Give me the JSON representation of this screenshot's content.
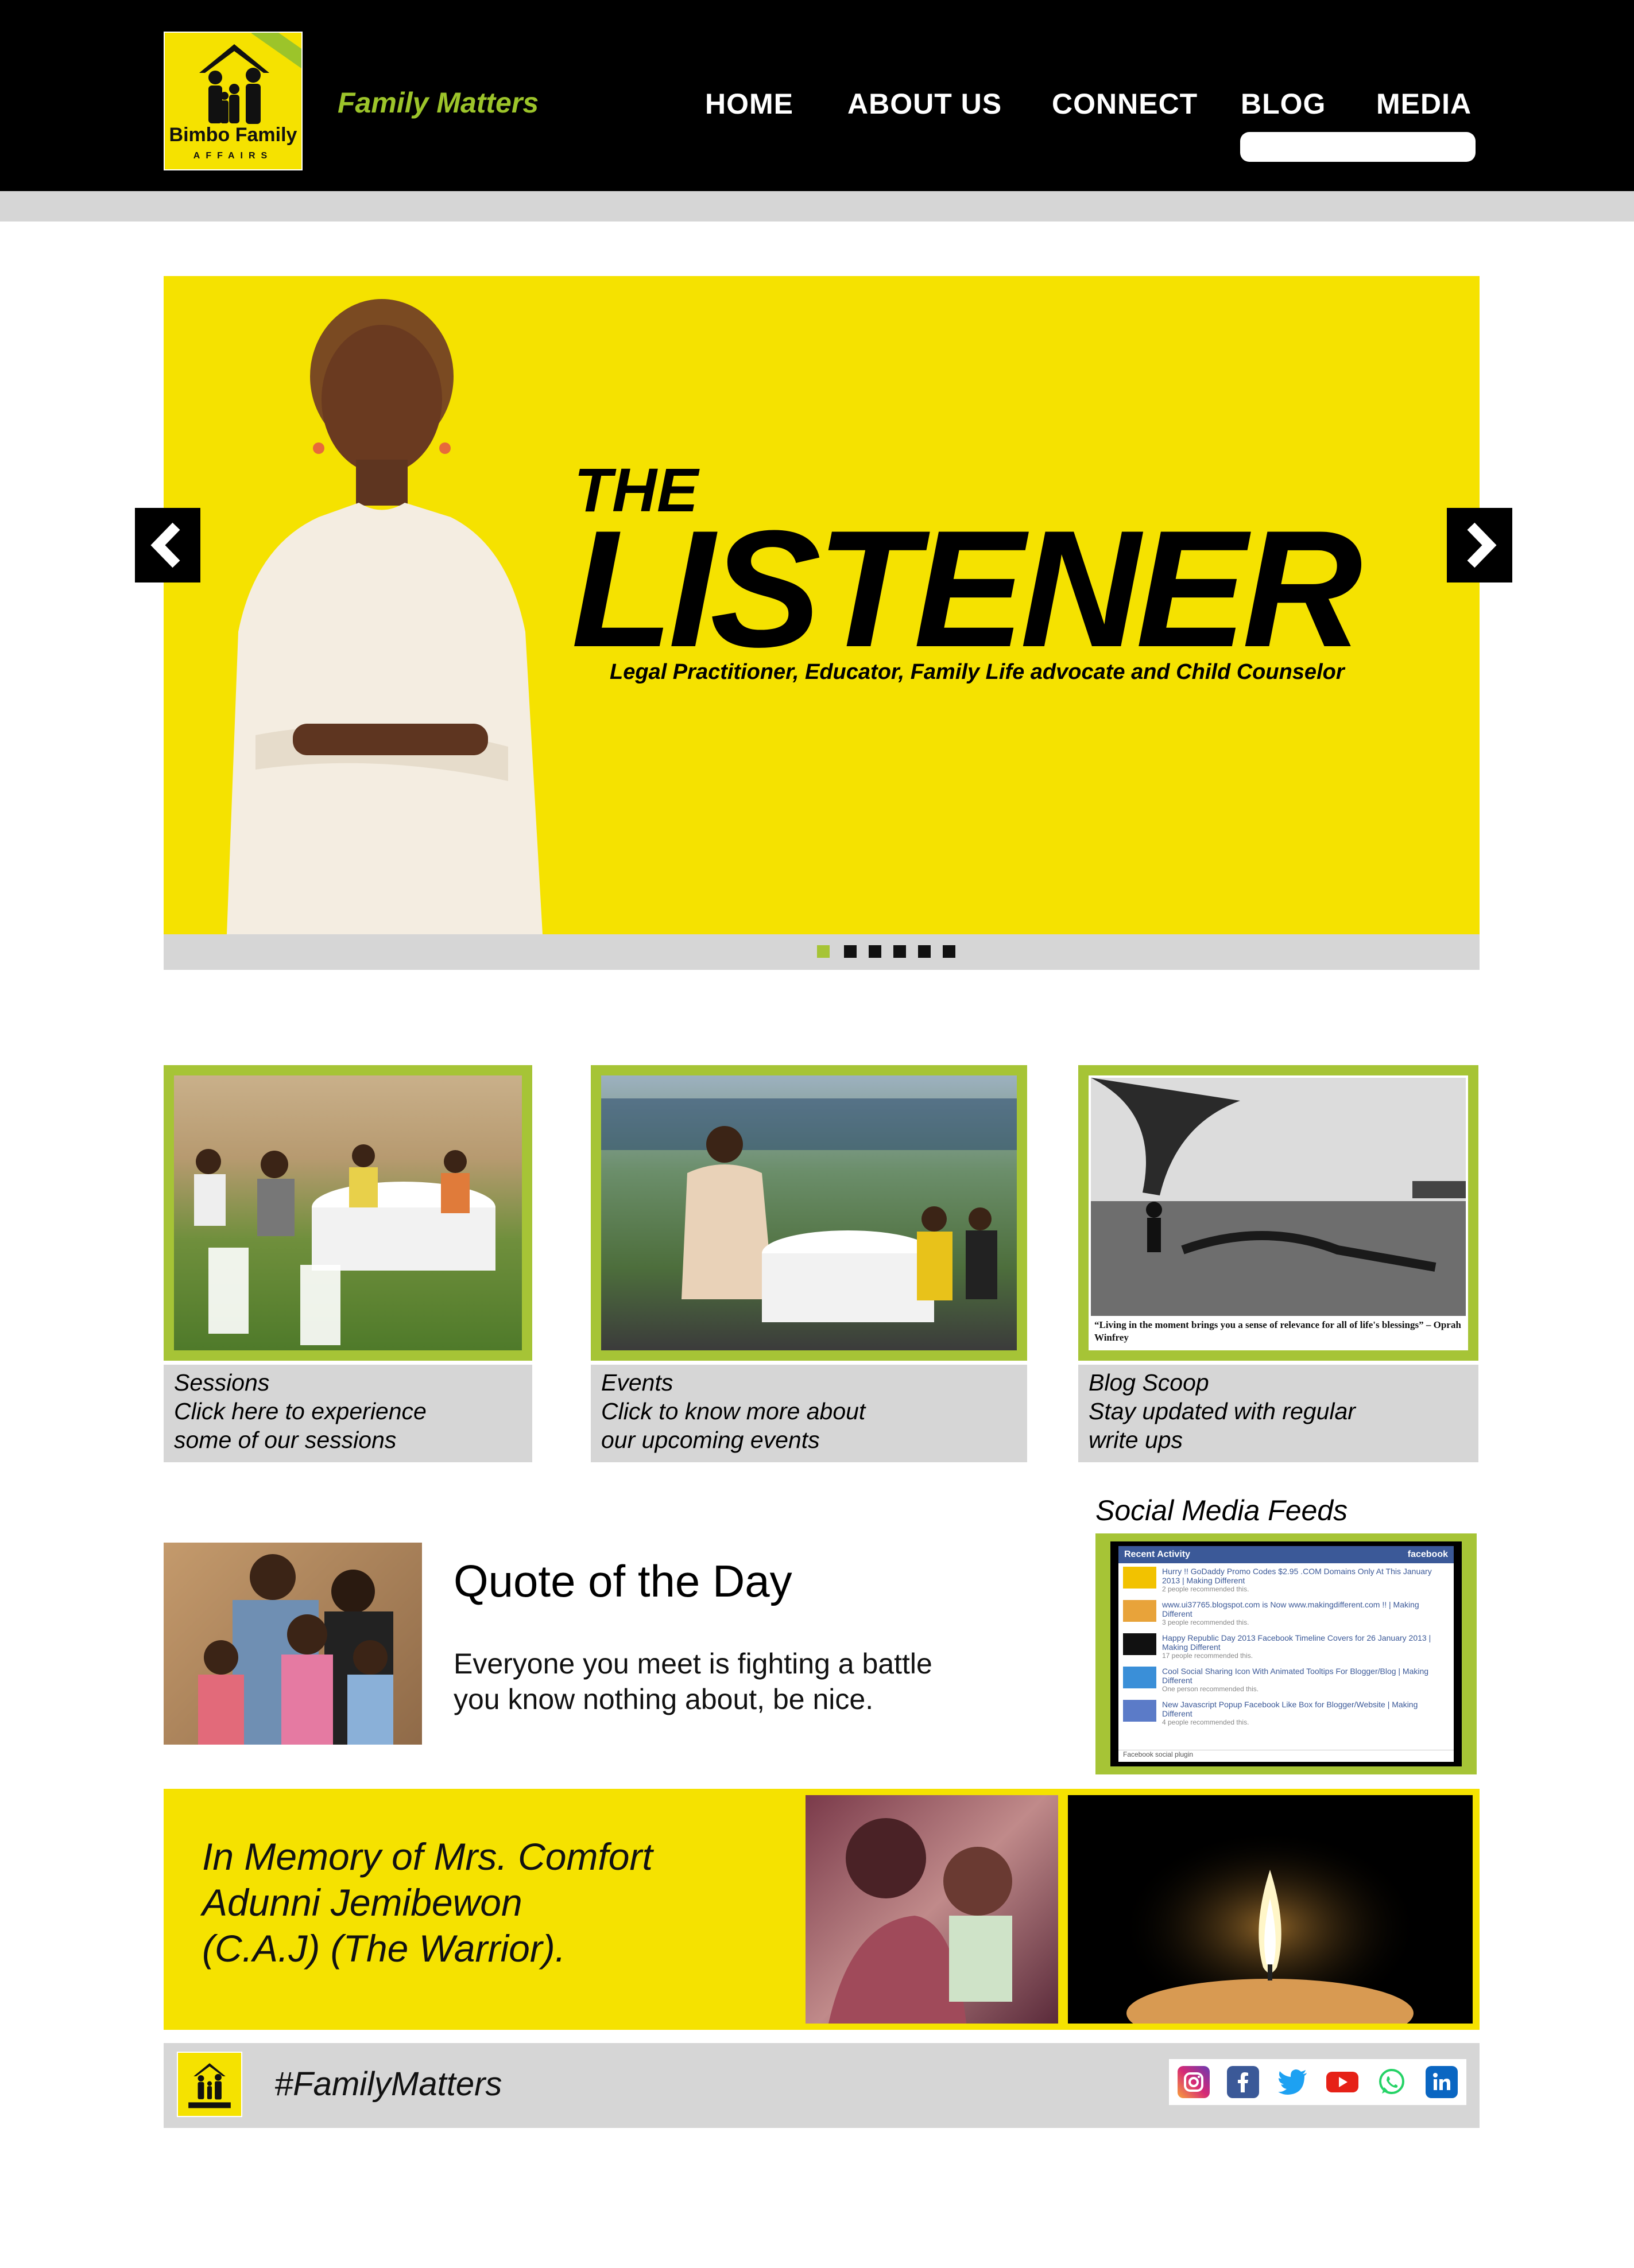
{
  "header": {
    "logo_text": "Bimbo Family",
    "logo_subtext": "AFFAIRS",
    "tagline": "Family Matters",
    "nav": [
      "HOME",
      "ABOUT US",
      "CONNECT",
      "BLOG",
      "MEDIA"
    ],
    "active_nav": "BLOG"
  },
  "hero": {
    "title_small": "THE",
    "title_big": "LISTENER",
    "subtitle": "Legal Practitioner, Educator, Family Life advocate and Child Counselor",
    "slide_count": 6,
    "active_slide": 1,
    "prev_icon": "chevron-left-icon",
    "next_icon": "chevron-right-icon"
  },
  "cards": [
    {
      "title": "Sessions",
      "line1": "Click here to experience",
      "line2": "some of our sessions"
    },
    {
      "title": "Events",
      "line1": "Click to know more about",
      "line2": "our upcoming events"
    },
    {
      "title": "Blog Scoop",
      "line1": "Stay updated with regular",
      "line2": "write ups",
      "image_quote": "“Living in the moment brings you a sense of relevance for all of life's blessings” – Oprah Winfrey"
    }
  ],
  "quote": {
    "title": "Quote of the Day",
    "text": "Everyone you meet is fighting a battle you know nothing about, be nice."
  },
  "social_feeds": {
    "title": "Social Media Feeds",
    "panel_header": "Recent Activity",
    "panel_brand": "facebook",
    "items": [
      {
        "text": "Hurry !! GoDaddy Promo Codes $2.95 .COM Domains Only At This January 2013 | Making Different",
        "meta": "2 people recommended this."
      },
      {
        "text": "www.ui37765.blogspot.com is Now www.makingdifferent.com !! | Making Different",
        "meta": "3 people recommended this."
      },
      {
        "text": "Happy Republic Day 2013 Facebook Timeline Covers for 26 January 2013 | Making Different",
        "meta": "17 people recommended this."
      },
      {
        "text": "Cool Social Sharing Icon With Animated Tooltips For Blogger/Blog | Making Different",
        "meta": "One person recommended this."
      },
      {
        "text": "New Javascript Popup Facebook Like Box for Blogger/Website | Making Different",
        "meta": "4 people recommended this."
      }
    ],
    "footer": "Facebook social plugin"
  },
  "memorial": {
    "line1": "In Memory of Mrs. Comfort",
    "line2": "Adunni Jemibewon",
    "line3": "(C.A.J) (The Warrior)."
  },
  "footer": {
    "hashtag": "#FamilyMatters",
    "social_icons": [
      "instagram-icon",
      "facebook-icon",
      "twitter-icon",
      "youtube-icon",
      "whatsapp-icon",
      "linkedin-icon"
    ]
  },
  "colors": {
    "brand_yellow": "#f5e200",
    "accent_green": "#a6c436",
    "header_black": "#000000",
    "panel_gray": "#d6d6d6"
  }
}
